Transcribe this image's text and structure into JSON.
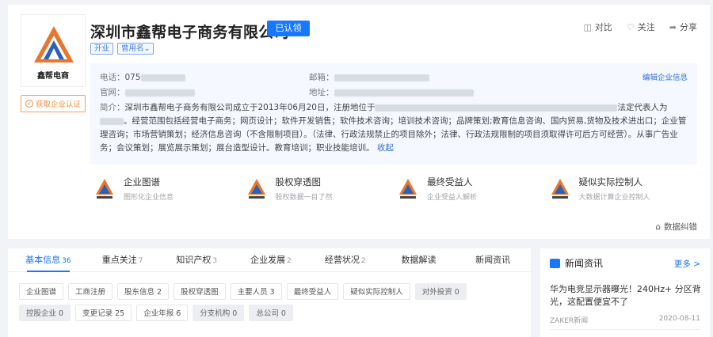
{
  "company": {
    "name": "深圳市鑫帮电子商务有限公司",
    "claimed_label": "已认领",
    "logo_text": "鑫帮电商",
    "cert_label": "获取企业认证",
    "tags": [
      "开业",
      "曾用名⌄"
    ]
  },
  "actions": {
    "compare": "对比",
    "follow": "关注",
    "share": "分享"
  },
  "info": {
    "phone_label": "电话：",
    "phone_value": "075",
    "email_label": "邮箱：",
    "website_label": "官网：",
    "address_label": "地址：",
    "edit_label": "编辑企业信息",
    "brief_label": "简介：",
    "brief_part1": "深圳市鑫帮电子商务有限公司成立于2013年06月20日，注册地位于",
    "brief_part2": "法定代表人为",
    "brief_part3": "。经营范围包括经营电子商务；网页设计；软件开发销售；软件技术咨询；培训技术咨询；品牌策划;教育信息咨询、国内贸易,货物及技术进出口；企业管理咨询；市场营销策划；经济信息咨询（不含限制项目）。（法律、行政法规禁止的项目除外；法律、行政法规限制的项目须取得许可后方可经营）。从事广告业务；会议策划；展览展示策划；展台造型设计。教育培训；职业技能培训。",
    "collapse": "收起"
  },
  "features": [
    {
      "name": "企业图谱",
      "desc": "图形化企业信息"
    },
    {
      "name": "股权穿透图",
      "desc": "股权数据一目了然"
    },
    {
      "name": "最终受益人",
      "desc": "企业受益人解析"
    },
    {
      "name": "疑似实际控制人",
      "desc": "大数据计算企业控制人"
    }
  ],
  "data_correct": "数据纠错",
  "tabs": [
    {
      "label": "基本信息",
      "count": "36"
    },
    {
      "label": "重点关注",
      "count": "7"
    },
    {
      "label": "知识产权",
      "count": "3"
    },
    {
      "label": "企业发展",
      "count": "2"
    },
    {
      "label": "经营状况",
      "count": "2"
    },
    {
      "label": "数据解读",
      "count": ""
    },
    {
      "label": "新闻资讯",
      "count": ""
    }
  ],
  "chips": [
    "企业图谱",
    "工商注册",
    "股东信息 2",
    "股权穿透图",
    "主要人员 3",
    "最终受益人",
    "疑似实际控制人",
    "对外投资 0",
    "控股企业 0",
    "变更记录 25",
    "企业年报 6",
    "分支机构 0",
    "总公司 0"
  ],
  "news": {
    "heading": "新闻资讯",
    "more": "更多 >",
    "title": "华为电竞显示器曝光！240Hz+ 分区背光，这配置便宜不了",
    "source": "ZAKER新闻",
    "date": "2020-08-11"
  },
  "colors": {
    "accent": "#1677ff",
    "cert": "#f08c3c",
    "panel": "#f5f8ff"
  }
}
